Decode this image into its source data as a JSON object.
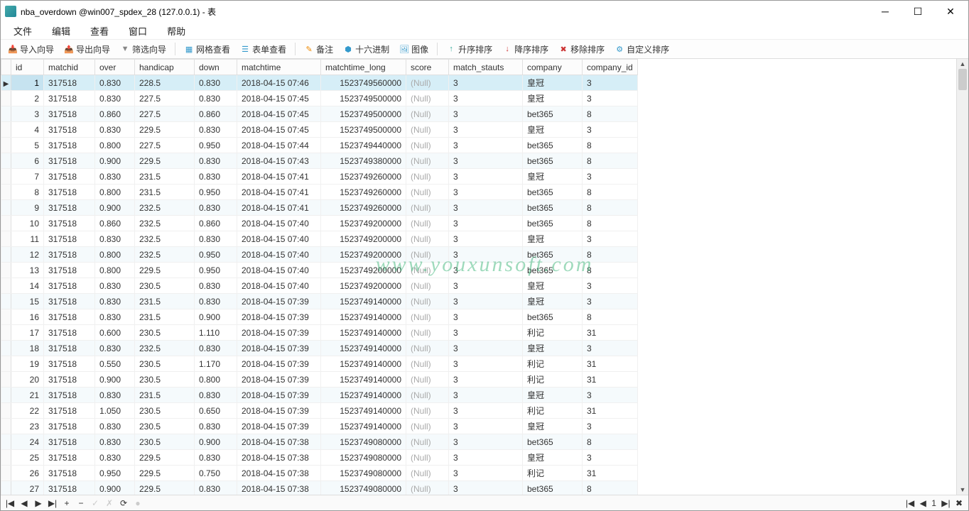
{
  "title": "nba_overdown @win007_spdex_28 (127.0.0.1) - 表",
  "menu": [
    "文件",
    "编辑",
    "查看",
    "窗口",
    "帮助"
  ],
  "toolbar": [
    {
      "icon": "📥",
      "cls": "ic-green",
      "label": "导入向导"
    },
    {
      "icon": "📤",
      "cls": "ic-orange",
      "label": "导出向导"
    },
    {
      "icon": "▼",
      "cls": "ic-gray",
      "label": "筛选向导"
    },
    {
      "sep": true
    },
    {
      "icon": "▦",
      "cls": "ic-blue",
      "label": "网格查看"
    },
    {
      "icon": "☰",
      "cls": "ic-blue",
      "label": "表单查看"
    },
    {
      "sep": true
    },
    {
      "icon": "✎",
      "cls": "ic-orange",
      "label": "备注"
    },
    {
      "icon": "⬢",
      "cls": "ic-blue",
      "label": "十六进制"
    },
    {
      "icon": "🖼",
      "cls": "ic-blue",
      "label": "图像"
    },
    {
      "sep": true
    },
    {
      "icon": "↑",
      "cls": "ic-green",
      "label": "升序排序"
    },
    {
      "icon": "↓",
      "cls": "ic-red",
      "label": "降序排序"
    },
    {
      "icon": "✖",
      "cls": "ic-red",
      "label": "移除排序"
    },
    {
      "icon": "⚙",
      "cls": "ic-blue",
      "label": "自定义排序"
    }
  ],
  "watermark": "www.youxunsoft.com",
  "columns": [
    {
      "key": "id",
      "label": "id",
      "w": 46,
      "align": "right"
    },
    {
      "key": "matchid",
      "label": "matchid",
      "w": 72
    },
    {
      "key": "over",
      "label": "over",
      "w": 56
    },
    {
      "key": "handicap",
      "label": "handicap",
      "w": 84
    },
    {
      "key": "down",
      "label": "down",
      "w": 60
    },
    {
      "key": "matchtime",
      "label": "matchtime",
      "w": 118
    },
    {
      "key": "matchtime_long",
      "label": "matchtime_long",
      "w": 120,
      "align": "right"
    },
    {
      "key": "score",
      "label": "score",
      "w": 60
    },
    {
      "key": "match_stauts",
      "label": "match_stauts",
      "w": 104
    },
    {
      "key": "company",
      "label": "company",
      "w": 84
    },
    {
      "key": "company_id",
      "label": "company_id",
      "w": 76
    }
  ],
  "rows": [
    {
      "id": 1,
      "matchid": "317518",
      "over": "0.830",
      "handicap": "228.5",
      "down": "0.830",
      "matchtime": "2018-04-15 07:46",
      "matchtime_long": "1523749560000",
      "score": "(Null)",
      "match_stauts": "3",
      "company": "皇冠",
      "company_id": "3"
    },
    {
      "id": 2,
      "matchid": "317518",
      "over": "0.830",
      "handicap": "227.5",
      "down": "0.830",
      "matchtime": "2018-04-15 07:45",
      "matchtime_long": "1523749500000",
      "score": "(Null)",
      "match_stauts": "3",
      "company": "皇冠",
      "company_id": "3"
    },
    {
      "id": 3,
      "matchid": "317518",
      "over": "0.860",
      "handicap": "227.5",
      "down": "0.860",
      "matchtime": "2018-04-15 07:45",
      "matchtime_long": "1523749500000",
      "score": "(Null)",
      "match_stauts": "3",
      "company": "bet365",
      "company_id": "8"
    },
    {
      "id": 4,
      "matchid": "317518",
      "over": "0.830",
      "handicap": "229.5",
      "down": "0.830",
      "matchtime": "2018-04-15 07:45",
      "matchtime_long": "1523749500000",
      "score": "(Null)",
      "match_stauts": "3",
      "company": "皇冠",
      "company_id": "3"
    },
    {
      "id": 5,
      "matchid": "317518",
      "over": "0.800",
      "handicap": "227.5",
      "down": "0.950",
      "matchtime": "2018-04-15 07:44",
      "matchtime_long": "1523749440000",
      "score": "(Null)",
      "match_stauts": "3",
      "company": "bet365",
      "company_id": "8"
    },
    {
      "id": 6,
      "matchid": "317518",
      "over": "0.900",
      "handicap": "229.5",
      "down": "0.830",
      "matchtime": "2018-04-15 07:43",
      "matchtime_long": "1523749380000",
      "score": "(Null)",
      "match_stauts": "3",
      "company": "bet365",
      "company_id": "8"
    },
    {
      "id": 7,
      "matchid": "317518",
      "over": "0.830",
      "handicap": "231.5",
      "down": "0.830",
      "matchtime": "2018-04-15 07:41",
      "matchtime_long": "1523749260000",
      "score": "(Null)",
      "match_stauts": "3",
      "company": "皇冠",
      "company_id": "3"
    },
    {
      "id": 8,
      "matchid": "317518",
      "over": "0.800",
      "handicap": "231.5",
      "down": "0.950",
      "matchtime": "2018-04-15 07:41",
      "matchtime_long": "1523749260000",
      "score": "(Null)",
      "match_stauts": "3",
      "company": "bet365",
      "company_id": "8"
    },
    {
      "id": 9,
      "matchid": "317518",
      "over": "0.900",
      "handicap": "232.5",
      "down": "0.830",
      "matchtime": "2018-04-15 07:41",
      "matchtime_long": "1523749260000",
      "score": "(Null)",
      "match_stauts": "3",
      "company": "bet365",
      "company_id": "8"
    },
    {
      "id": 10,
      "matchid": "317518",
      "over": "0.860",
      "handicap": "232.5",
      "down": "0.860",
      "matchtime": "2018-04-15 07:40",
      "matchtime_long": "1523749200000",
      "score": "(Null)",
      "match_stauts": "3",
      "company": "bet365",
      "company_id": "8"
    },
    {
      "id": 11,
      "matchid": "317518",
      "over": "0.830",
      "handicap": "232.5",
      "down": "0.830",
      "matchtime": "2018-04-15 07:40",
      "matchtime_long": "1523749200000",
      "score": "(Null)",
      "match_stauts": "3",
      "company": "皇冠",
      "company_id": "3"
    },
    {
      "id": 12,
      "matchid": "317518",
      "over": "0.800",
      "handicap": "232.5",
      "down": "0.950",
      "matchtime": "2018-04-15 07:40",
      "matchtime_long": "1523749200000",
      "score": "(Null)",
      "match_stauts": "3",
      "company": "bet365",
      "company_id": "8"
    },
    {
      "id": 13,
      "matchid": "317518",
      "over": "0.800",
      "handicap": "229.5",
      "down": "0.950",
      "matchtime": "2018-04-15 07:40",
      "matchtime_long": "1523749200000",
      "score": "(Null)",
      "match_stauts": "3",
      "company": "bet365",
      "company_id": "8"
    },
    {
      "id": 14,
      "matchid": "317518",
      "over": "0.830",
      "handicap": "230.5",
      "down": "0.830",
      "matchtime": "2018-04-15 07:40",
      "matchtime_long": "1523749200000",
      "score": "(Null)",
      "match_stauts": "3",
      "company": "皇冠",
      "company_id": "3"
    },
    {
      "id": 15,
      "matchid": "317518",
      "over": "0.830",
      "handicap": "231.5",
      "down": "0.830",
      "matchtime": "2018-04-15 07:39",
      "matchtime_long": "1523749140000",
      "score": "(Null)",
      "match_stauts": "3",
      "company": "皇冠",
      "company_id": "3"
    },
    {
      "id": 16,
      "matchid": "317518",
      "over": "0.830",
      "handicap": "231.5",
      "down": "0.900",
      "matchtime": "2018-04-15 07:39",
      "matchtime_long": "1523749140000",
      "score": "(Null)",
      "match_stauts": "3",
      "company": "bet365",
      "company_id": "8"
    },
    {
      "id": 17,
      "matchid": "317518",
      "over": "0.600",
      "handicap": "230.5",
      "down": "1.110",
      "matchtime": "2018-04-15 07:39",
      "matchtime_long": "1523749140000",
      "score": "(Null)",
      "match_stauts": "3",
      "company": "利记",
      "company_id": "31"
    },
    {
      "id": 18,
      "matchid": "317518",
      "over": "0.830",
      "handicap": "232.5",
      "down": "0.830",
      "matchtime": "2018-04-15 07:39",
      "matchtime_long": "1523749140000",
      "score": "(Null)",
      "match_stauts": "3",
      "company": "皇冠",
      "company_id": "3"
    },
    {
      "id": 19,
      "matchid": "317518",
      "over": "0.550",
      "handicap": "230.5",
      "down": "1.170",
      "matchtime": "2018-04-15 07:39",
      "matchtime_long": "1523749140000",
      "score": "(Null)",
      "match_stauts": "3",
      "company": "利记",
      "company_id": "31"
    },
    {
      "id": 20,
      "matchid": "317518",
      "over": "0.900",
      "handicap": "230.5",
      "down": "0.800",
      "matchtime": "2018-04-15 07:39",
      "matchtime_long": "1523749140000",
      "score": "(Null)",
      "match_stauts": "3",
      "company": "利记",
      "company_id": "31"
    },
    {
      "id": 21,
      "matchid": "317518",
      "over": "0.830",
      "handicap": "231.5",
      "down": "0.830",
      "matchtime": "2018-04-15 07:39",
      "matchtime_long": "1523749140000",
      "score": "(Null)",
      "match_stauts": "3",
      "company": "皇冠",
      "company_id": "3"
    },
    {
      "id": 22,
      "matchid": "317518",
      "over": "1.050",
      "handicap": "230.5",
      "down": "0.650",
      "matchtime": "2018-04-15 07:39",
      "matchtime_long": "1523749140000",
      "score": "(Null)",
      "match_stauts": "3",
      "company": "利记",
      "company_id": "31"
    },
    {
      "id": 23,
      "matchid": "317518",
      "over": "0.830",
      "handicap": "230.5",
      "down": "0.830",
      "matchtime": "2018-04-15 07:39",
      "matchtime_long": "1523749140000",
      "score": "(Null)",
      "match_stauts": "3",
      "company": "皇冠",
      "company_id": "3"
    },
    {
      "id": 24,
      "matchid": "317518",
      "over": "0.830",
      "handicap": "230.5",
      "down": "0.900",
      "matchtime": "2018-04-15 07:38",
      "matchtime_long": "1523749080000",
      "score": "(Null)",
      "match_stauts": "3",
      "company": "bet365",
      "company_id": "8"
    },
    {
      "id": 25,
      "matchid": "317518",
      "over": "0.830",
      "handicap": "229.5",
      "down": "0.830",
      "matchtime": "2018-04-15 07:38",
      "matchtime_long": "1523749080000",
      "score": "(Null)",
      "match_stauts": "3",
      "company": "皇冠",
      "company_id": "3"
    },
    {
      "id": 26,
      "matchid": "317518",
      "over": "0.950",
      "handicap": "229.5",
      "down": "0.750",
      "matchtime": "2018-04-15 07:38",
      "matchtime_long": "1523749080000",
      "score": "(Null)",
      "match_stauts": "3",
      "company": "利记",
      "company_id": "31"
    },
    {
      "id": 27,
      "matchid": "317518",
      "over": "0.900",
      "handicap": "229.5",
      "down": "0.830",
      "matchtime": "2018-04-15 07:38",
      "matchtime_long": "1523749080000",
      "score": "(Null)",
      "match_stauts": "3",
      "company": "bet365",
      "company_id": "8"
    }
  ],
  "status_nav": {
    "first": "|◀",
    "prev": "◀",
    "next": "▶",
    "last": "▶|",
    "add": "+",
    "del": "−",
    "ok": "✓",
    "cancel": "✗",
    "refresh": "⟳",
    "stop": "●"
  },
  "status_right": {
    "first": "|◀",
    "prev": "◀",
    "page": "1",
    "next": "▶|",
    "apply": "✖"
  }
}
